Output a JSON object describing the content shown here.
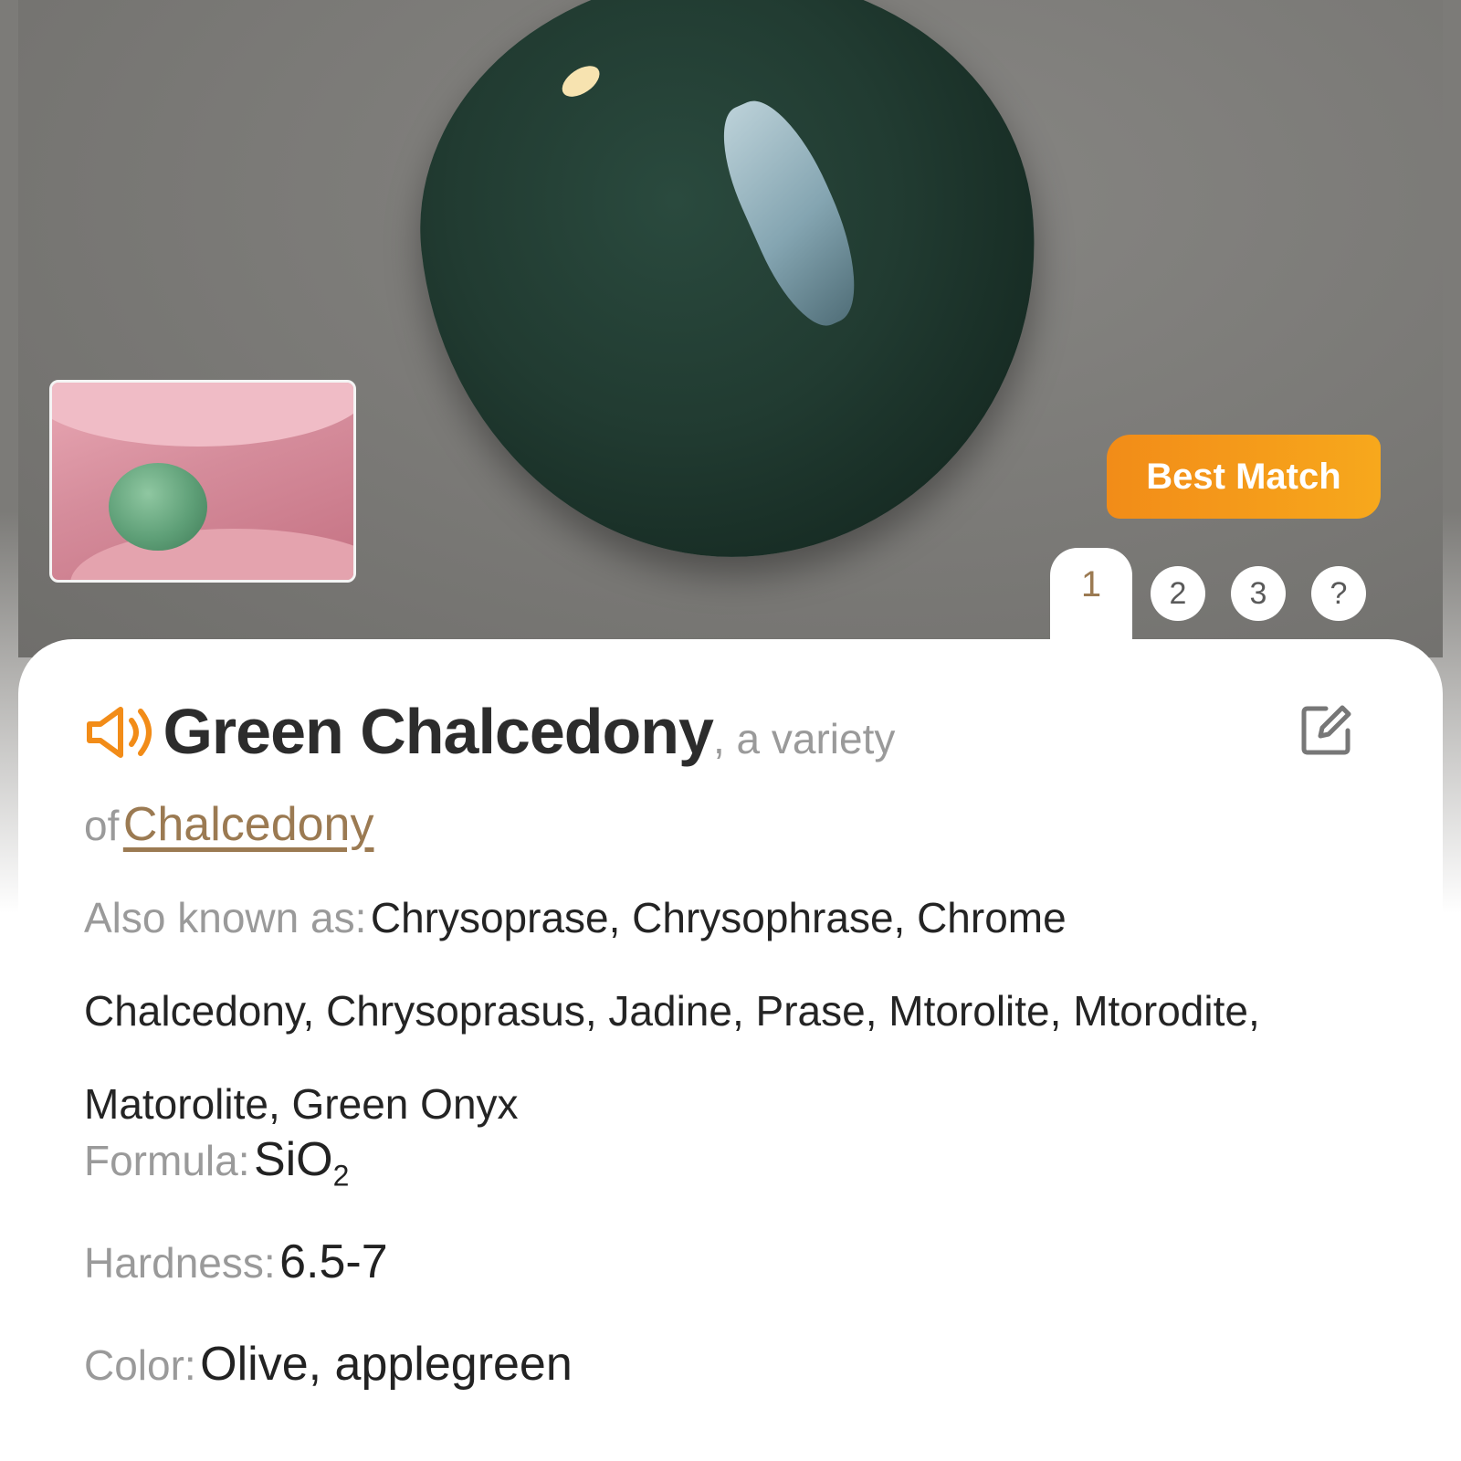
{
  "hero": {
    "badge": "Best Match",
    "pages": [
      "1",
      "2",
      "3",
      "?"
    ]
  },
  "result": {
    "name": "Green Chalcedony",
    "variety_prefix": ", a variety",
    "of_word": "of",
    "parent": "Chalcedony"
  },
  "details": {
    "aka_label": "Also known as:",
    "aka_value": "Chrysoprase, Chrysophrase, Chrome Chalcedony, Chrysoprasus, Jadine, Prase, Mtorolite, Mtorodite, Matorolite, Green Onyx",
    "formula_label": "Formula:",
    "formula_main": "SiO",
    "formula_sub": "2",
    "hardness_label": "Hardness:",
    "hardness_value": "6.5-7",
    "color_label": "Color:",
    "color_value": "Olive, applegreen"
  },
  "colors": {
    "accent": "#f28c18",
    "link": "#9b7a52"
  },
  "icons": [
    "speaker-icon",
    "edit-icon"
  ]
}
